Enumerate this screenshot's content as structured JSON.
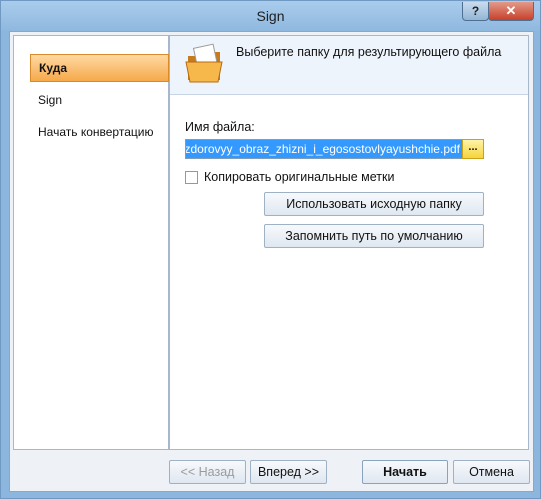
{
  "window": {
    "title": "Sign",
    "help_label": "?",
    "close_label": "✕"
  },
  "sidebar": {
    "items": [
      {
        "label": "Куда",
        "active": true
      },
      {
        "label": "Sign",
        "active": false
      },
      {
        "label": "Начать конвертацию",
        "active": false
      }
    ]
  },
  "header": {
    "text": "Выберите папку для результирующего файла"
  },
  "form": {
    "file_label": "Имя файла:",
    "file_value": "zdorovyy_obraz_zhizni_i_egosostovlyayushchie.pdf",
    "browse_label": "...",
    "checkbox_label": "Копировать оригинальные метки",
    "checkbox_checked": false,
    "use_source_label": "Использовать исходную папку",
    "remember_path_label": "Запомнить путь по умолчанию"
  },
  "footer": {
    "back_label": "<< Назад",
    "next_label": "Вперед >>",
    "start_label": "Начать",
    "cancel_label": "Отмена"
  },
  "colors": {
    "accent": "#f5a94a",
    "selection": "#3399ff",
    "frame": "#8cb6de"
  },
  "icons": {
    "header": "folder-document-icon"
  }
}
